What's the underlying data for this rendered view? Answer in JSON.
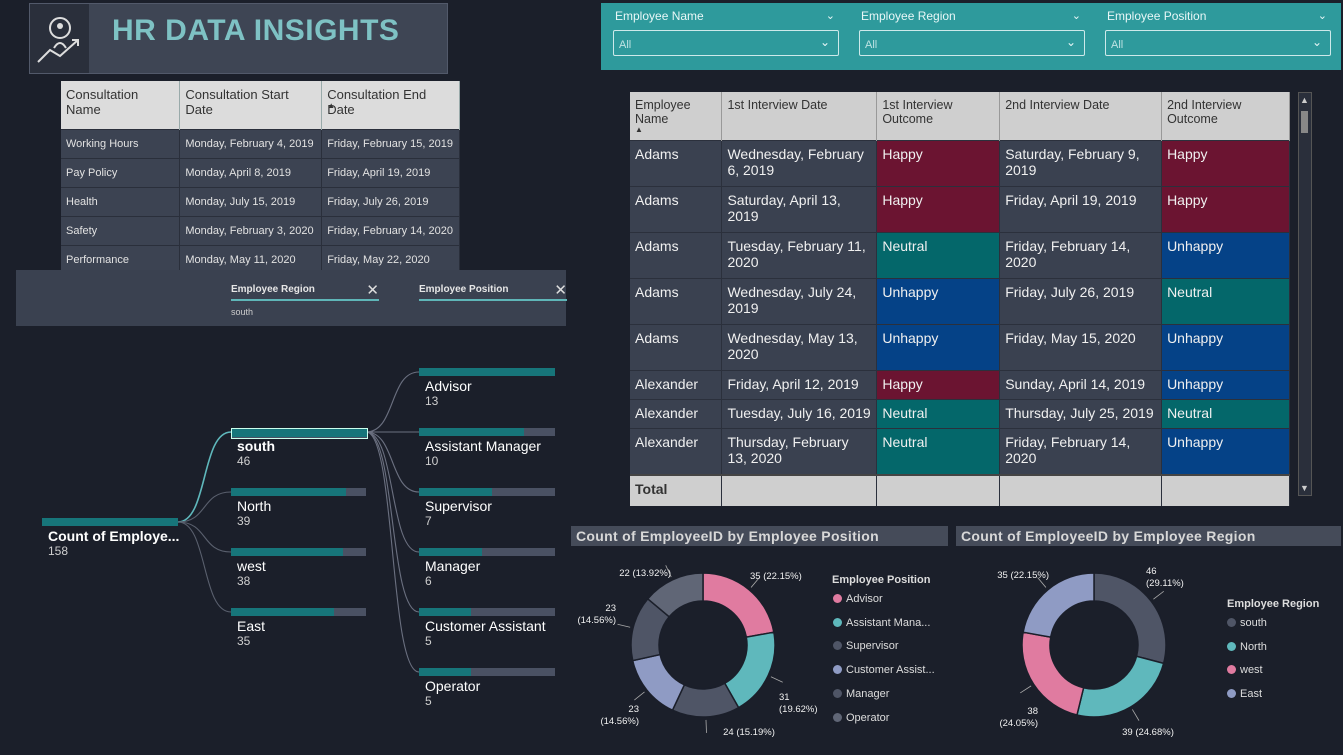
{
  "header": {
    "title": "HR DATA INSIGHTS",
    "logo_icon": "analyst-chart-icon"
  },
  "slicers": [
    {
      "label": "Employee Name",
      "value": "All"
    },
    {
      "label": "Employee Region",
      "value": "All"
    },
    {
      "label": "Employee Position",
      "value": "All"
    }
  ],
  "consultations": {
    "headers": [
      "Consultation Name",
      "Consultation Start Date",
      "Consultation End Date"
    ],
    "rows": [
      [
        "Working Hours",
        "Monday, February 4, 2019",
        "Friday, February 15, 2019"
      ],
      [
        "Pay Policy",
        "Monday, April 8, 2019",
        "Friday, April 19, 2019"
      ],
      [
        "Health",
        "Monday, July 15, 2019",
        "Friday, July 26, 2019"
      ],
      [
        "Safety",
        "Monday, February 3, 2020",
        "Friday, February 14, 2020"
      ],
      [
        "Performance",
        "Monday, May 11, 2020",
        "Friday, May 22, 2020"
      ]
    ]
  },
  "filters": [
    {
      "label": "Employee Region",
      "value": "south"
    },
    {
      "label": "Employee Position",
      "value": ""
    }
  ],
  "decomposition": {
    "root": {
      "label": "Count of Employe...",
      "value": "158",
      "fill": 1.0
    },
    "regions": [
      {
        "label": "south",
        "value": "46",
        "fill": 1.0,
        "selected": true
      },
      {
        "label": "North",
        "value": "39",
        "fill": 0.85
      },
      {
        "label": "west",
        "value": "38",
        "fill": 0.83
      },
      {
        "label": "East",
        "value": "35",
        "fill": 0.76
      }
    ],
    "positions": [
      {
        "label": "Advisor",
        "value": "13",
        "fill": 1.0
      },
      {
        "label": "Assistant Manager",
        "value": "10",
        "fill": 0.77
      },
      {
        "label": "Supervisor",
        "value": "7",
        "fill": 0.54
      },
      {
        "label": "Manager",
        "value": "6",
        "fill": 0.46
      },
      {
        "label": "Customer Assistant",
        "value": "5",
        "fill": 0.38
      },
      {
        "label": "Operator",
        "value": "5",
        "fill": 0.38
      }
    ]
  },
  "interviews": {
    "headers": [
      "Employee Name",
      "1st Interview Date",
      "1st Interview Outcome",
      "2nd Interview Date",
      "2nd Interview Outcome"
    ],
    "rows": [
      [
        "Adams",
        "Wednesday, February 6, 2019",
        "Happy",
        "Saturday, February 9, 2019",
        "Happy"
      ],
      [
        "Adams",
        "Saturday, April 13, 2019",
        "Happy",
        "Friday, April 19, 2019",
        "Happy"
      ],
      [
        "Adams",
        "Tuesday, February 11, 2020",
        "Neutral",
        "Friday, February 14, 2020",
        "Unhappy"
      ],
      [
        "Adams",
        "Wednesday, July 24, 2019",
        "Unhappy",
        "Friday, July 26, 2019",
        "Neutral"
      ],
      [
        "Adams",
        "Wednesday, May 13, 2020",
        "Unhappy",
        "Friday, May 15, 2020",
        "Unhappy"
      ],
      [
        "Alexander",
        "Friday, April 12, 2019",
        "Happy",
        "Sunday, April 14, 2019",
        "Unhappy"
      ],
      [
        "Alexander",
        "Tuesday, July 16, 2019",
        "Neutral",
        "Thursday, July 25, 2019",
        "Neutral"
      ],
      [
        "Alexander",
        "Thursday, February 13, 2020",
        "Neutral",
        "Friday, February 14, 2020",
        "Unhappy"
      ]
    ],
    "total_label": "Total"
  },
  "chart_data": [
    {
      "type": "pie",
      "title": "Count of EmployeeID by Employee Position",
      "legend_title": "Employee Position",
      "categories": [
        "Advisor",
        "Assistant Manager",
        "Supervisor",
        "Customer Assistant",
        "Manager",
        "Operator"
      ],
      "legend_labels": [
        "Advisor",
        "Assistant Mana...",
        "Supervisor",
        "Customer Assist...",
        "Manager",
        "Operator"
      ],
      "values": [
        35,
        31,
        24,
        23,
        23,
        22
      ],
      "labels": [
        "35 (22.15%)",
        "31 (19.62%)",
        "24 (15.19%)",
        "23 (14.56%)",
        "23 (14.56%)",
        "22 (13.92%)"
      ],
      "colors": [
        "#e07ba0",
        "#5fb8bc",
        "#4f5566",
        "#8f9bc4",
        "#4f5566",
        "#606676"
      ],
      "legend": "right"
    },
    {
      "type": "pie",
      "title": "Count of EmployeeID by Employee Region",
      "legend_title": "Employee Region",
      "categories": [
        "south",
        "North",
        "west",
        "East"
      ],
      "legend_labels": [
        "south",
        "North",
        "west",
        "East"
      ],
      "values": [
        46,
        39,
        38,
        35
      ],
      "labels": [
        "46 (29.11%)",
        "39 (24.68%)",
        "38 (24.05%)",
        "35 (22.15%)"
      ],
      "colors": [
        "#4f5566",
        "#5fb8bc",
        "#e07ba0",
        "#8f9bc4"
      ],
      "legend": "right"
    }
  ]
}
